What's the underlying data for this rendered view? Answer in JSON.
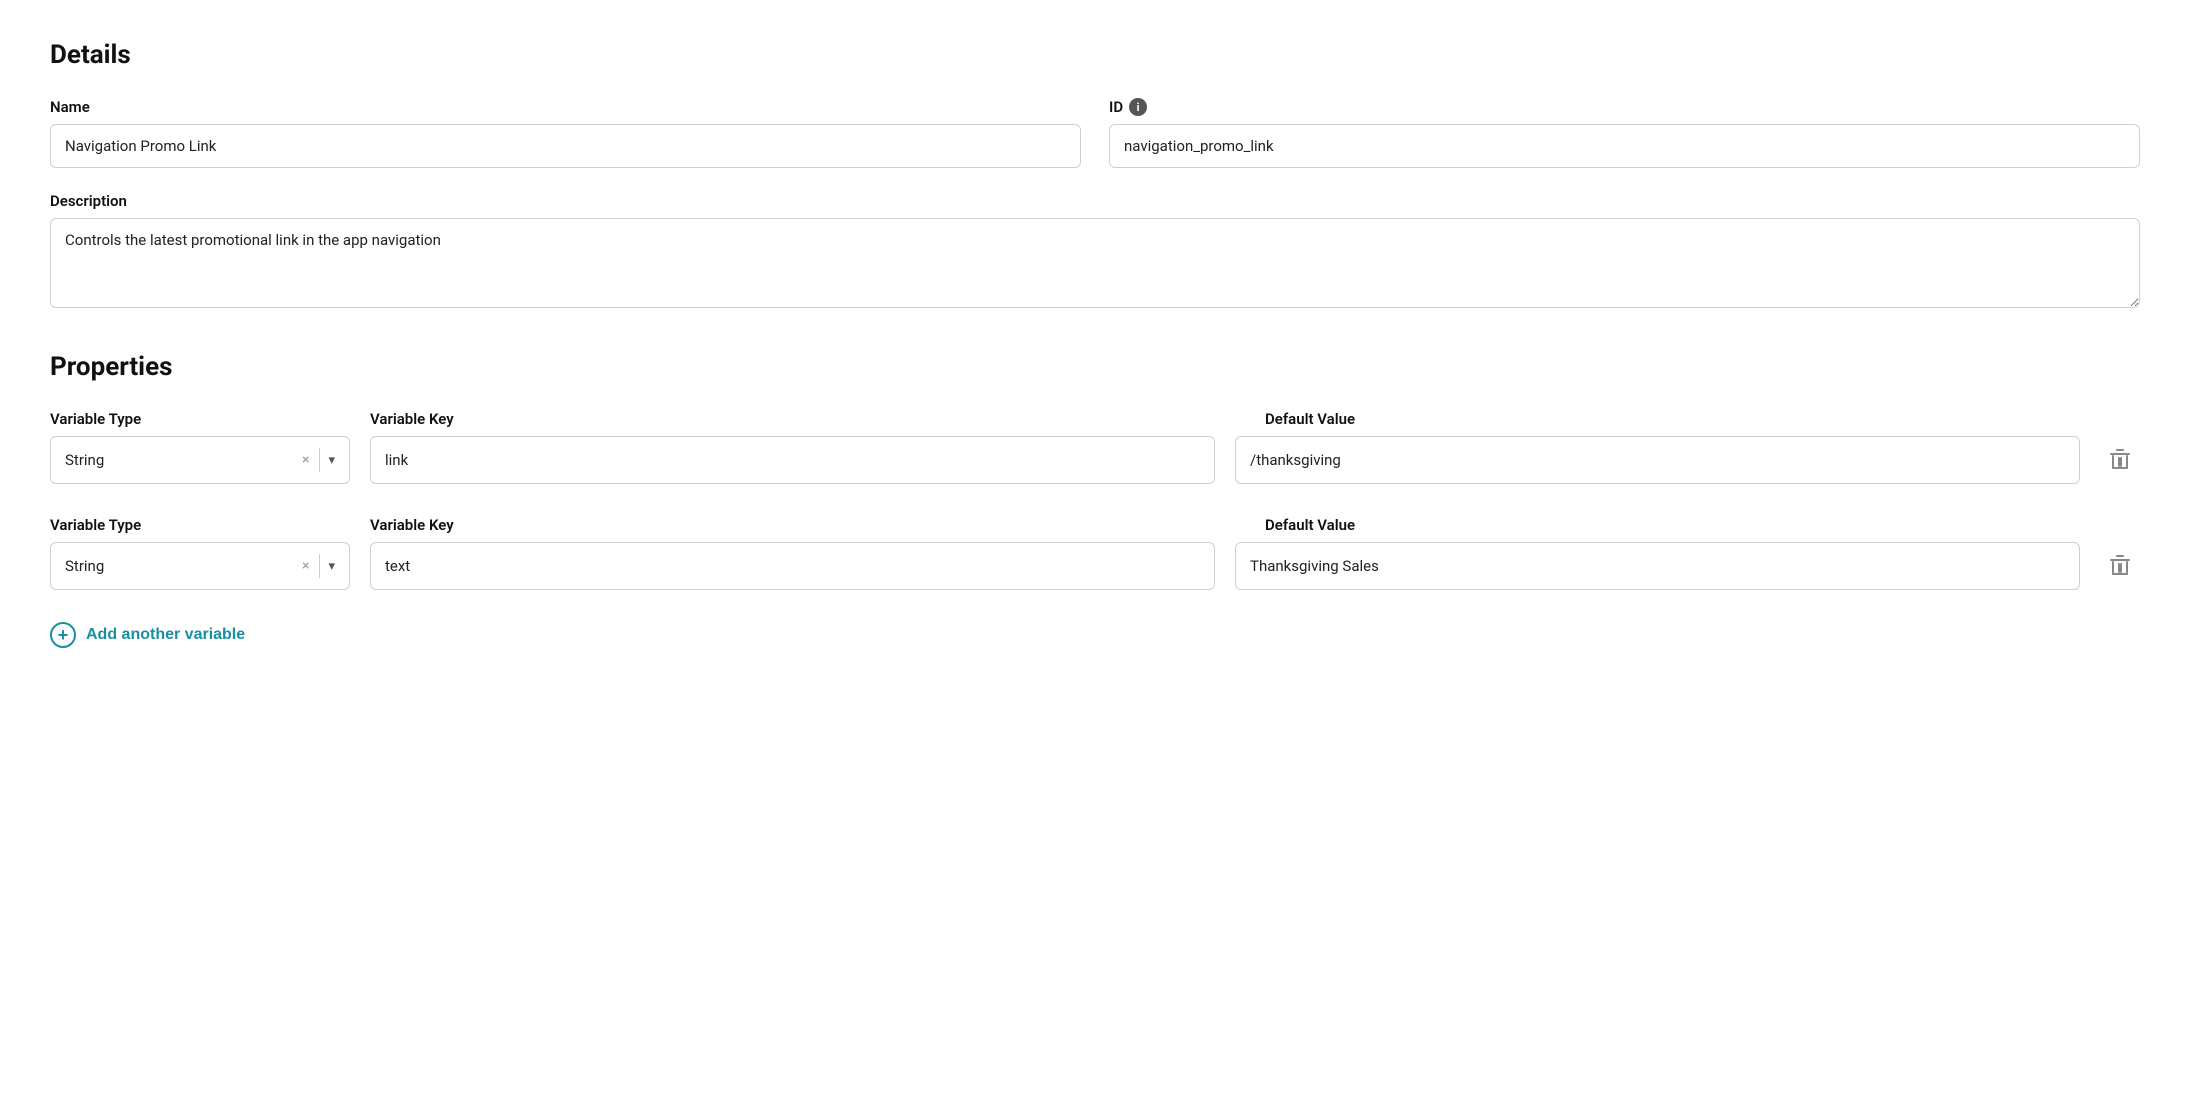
{
  "details": {
    "section_title": "Details",
    "name_label": "Name",
    "name_value": "Navigation Promo Link",
    "id_label": "ID",
    "id_info": "i",
    "id_value": "navigation_promo_link",
    "description_label": "Description",
    "description_value": "Controls the latest promotional link in the app navigation"
  },
  "properties": {
    "section_title": "Properties",
    "variables": [
      {
        "type_label": "Variable Type",
        "type_value": "String",
        "key_label": "Variable Key",
        "key_value": "link",
        "default_label": "Default Value",
        "default_value": "/thanksgiving"
      },
      {
        "type_label": "Variable Type",
        "type_value": "String",
        "key_label": "Variable Key",
        "key_value": "text",
        "default_label": "Default Value",
        "default_value": "Thanksgiving Sales"
      }
    ],
    "add_variable_label": "Add another variable"
  },
  "icons": {
    "info": "i",
    "clear": "×",
    "chevron_down": "▾",
    "trash": "🗑",
    "plus": "+"
  }
}
